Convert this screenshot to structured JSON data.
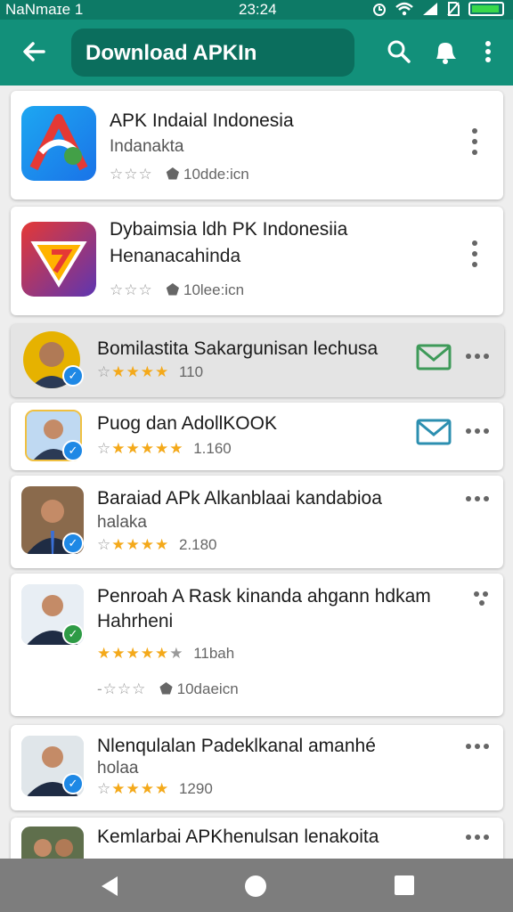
{
  "status_bar": {
    "carrier": "NaNmaɪe 1",
    "time": "23:24",
    "icons": [
      "record-icon",
      "image-icon",
      "alarm-icon",
      "wifi-icon",
      "signal-icon",
      "no-sim-icon",
      "battery-icon"
    ]
  },
  "app_bar": {
    "title": "Download APKIn",
    "back_icon": "arrow-left-icon",
    "actions": [
      "search-icon",
      "notification-bell-icon",
      "more-vert-icon"
    ]
  },
  "colors": {
    "status_bar": "#0d7a66",
    "app_bar": "#12907a",
    "title_box": "#0b6e5d",
    "star_on": "#f4a91a",
    "verified_blue": "#1e88e5",
    "verified_green": "#2e9b45",
    "mail_green": "#3e9a59",
    "mail_blue": "#2c8fb0"
  },
  "items": [
    {
      "title": "APK Indaial Indonesia",
      "subtitle": "Indanakta",
      "stars_filled": 0,
      "stars_total": 3,
      "rating_text": "10dde:icn"
    },
    {
      "title": "Dybaimsia ldh PK Indonesiia",
      "subtitle": "Henanacahinda",
      "stars_filled": 0,
      "stars_total": 3,
      "rating_text": "10lee:icn"
    },
    {
      "title": "Bomilastita Sakargunisan lechusa",
      "stars_filled": 4,
      "stars_total": 5,
      "rating_text": "110",
      "selected": true
    },
    {
      "title": "Puog dan AdollKOOK",
      "stars_filled": 5,
      "stars_total": 5,
      "rating_text": "1.160"
    },
    {
      "title": "Baraiad APk Alkanblaai kandabioa",
      "subtitle": "halaka",
      "stars_filled": 4,
      "stars_total": 5,
      "rating_text": "2.180"
    },
    {
      "title": "Penroah A Rask kinanda ahgann hdkam",
      "subtitle": "Hahrheni",
      "stars_filled": 4,
      "stars_total": 5,
      "rating_text": "11bah",
      "rating2_text": "10daeicn"
    },
    {
      "title": "Nlenqulalan Padeklkanal amanhé",
      "subtitle": "holaa",
      "stars_filled": 4,
      "stars_total": 5,
      "rating_text": "1290"
    },
    {
      "title": "Kemlarbai APKhenulsan lenakoita"
    }
  ],
  "nav_bar": {
    "buttons": [
      "back-triangle-icon",
      "home-circle-icon",
      "recents-square-icon"
    ]
  }
}
